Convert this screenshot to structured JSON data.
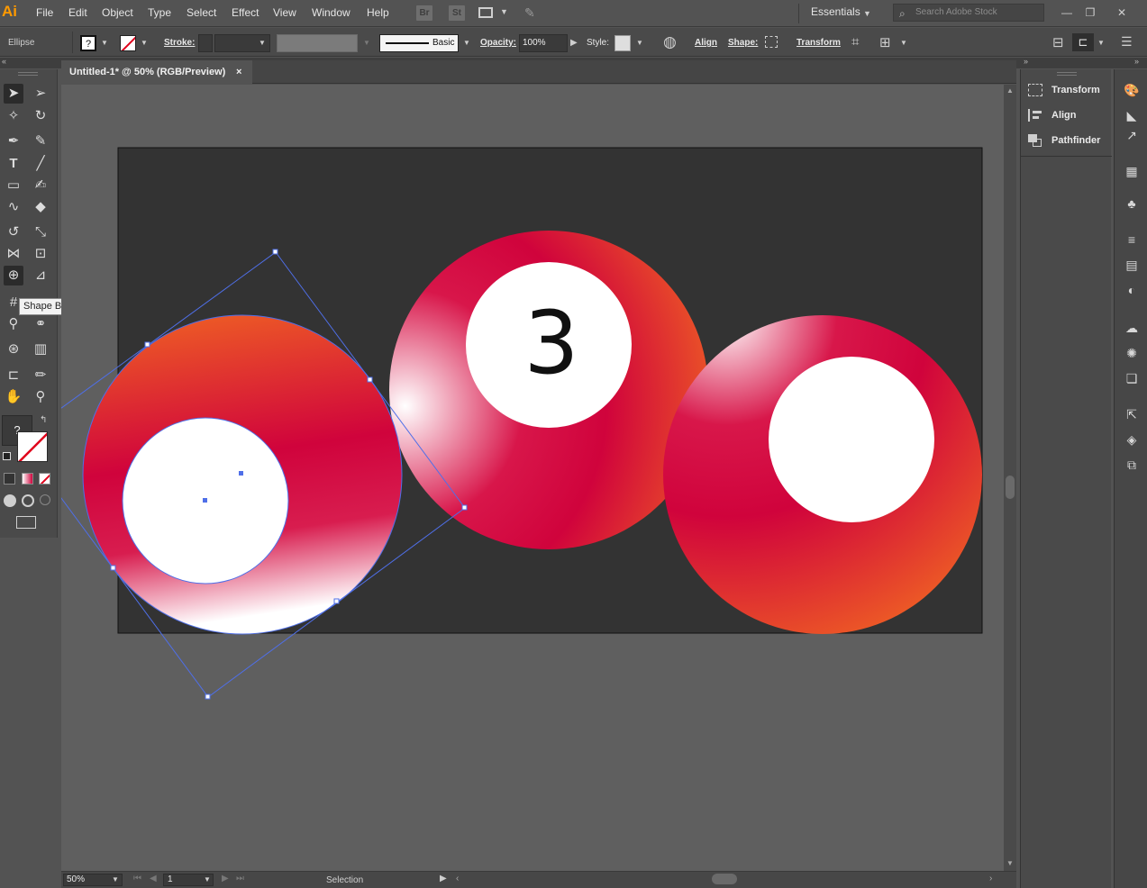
{
  "app": {
    "logo": "Ai"
  },
  "menu": [
    "File",
    "Edit",
    "Object",
    "Type",
    "Select",
    "Effect",
    "View",
    "Window",
    "Help"
  ],
  "bridge": [
    "Br",
    "St"
  ],
  "workspace": "Essentials",
  "search": {
    "placeholder": "Search Adobe Stock"
  },
  "control": {
    "selection_type": "Ellipse",
    "fill_label": "?",
    "stroke_label": "Stroke:",
    "brush_label": "Basic",
    "opacity_label": "Opacity:",
    "opacity_value": "100%",
    "style_label": "Style:",
    "align_label": "Align",
    "shape_label": "Shape:",
    "transform_label": "Transform"
  },
  "document": {
    "tab_title": "Untitled-1* @ 50% (RGB/Preview)",
    "close": "×"
  },
  "tooltip": "Shape Builder Tool (Shift+M)",
  "toolbox": {
    "fill_question": "?"
  },
  "canvas": {
    "ball_number": "3"
  },
  "panels": [
    "Transform",
    "Align",
    "Pathfinder"
  ],
  "status": {
    "zoom": "50%",
    "artboard": "1",
    "mode": "Selection"
  },
  "colors": {
    "accent_orange": "#f06423",
    "ball_red": "#d0033c",
    "artboard": "#333333",
    "selection_blue": "#4f6fe8"
  }
}
